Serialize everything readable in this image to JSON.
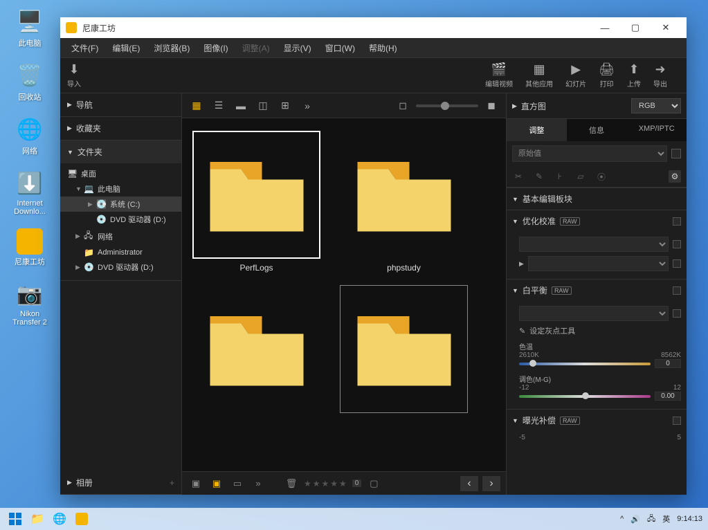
{
  "desktop": {
    "icons": [
      "此电脑",
      "回收站",
      "网络",
      "Internet Downlo...",
      "尼康工坊",
      "Nikon Transfer 2"
    ]
  },
  "window": {
    "title": "尼康工坊",
    "menu": [
      "文件(F)",
      "编辑(E)",
      "浏览器(B)",
      "图像(I)",
      "调整(A)",
      "显示(V)",
      "窗口(W)",
      "帮助(H)"
    ],
    "toolbar": {
      "import": "导入",
      "right": [
        "编辑视频",
        "其他应用",
        "幻灯片",
        "打印",
        "上传",
        "导出"
      ]
    }
  },
  "sidebar": {
    "nav": "导航",
    "fav": "收藏夹",
    "folders": "文件夹",
    "tree": {
      "desktop": "桌面",
      "thispc": "此电脑",
      "sysc": "系统 (C:)",
      "dvd": "DVD 驱动器 (D:)",
      "network": "网络",
      "admin": "Administrator",
      "dvd2": "DVD 驱动器 (D:)"
    },
    "album": "相册"
  },
  "thumbs": [
    "PerfLogs",
    "phpstudy",
    "",
    ""
  ],
  "filterbar": {
    "count": "0"
  },
  "right": {
    "histogram": "直方图",
    "rgb": "RGB",
    "tabs": [
      "调整",
      "信息",
      "XMP/IPTC"
    ],
    "original": "原始值",
    "basic": "基本编辑板块",
    "optimize": "优化校准",
    "wb": "白平衡",
    "graypoint": "设定灰点工具",
    "colortemp": "色温",
    "ct_lo": "2610K",
    "ct_hi": "8562K",
    "ct_val": "0",
    "tint": "调色(M-G)",
    "tint_lo": "-12",
    "tint_hi": "12",
    "tint_val": "0.00",
    "exposure": "曝光补偿",
    "exp_lo": "-5",
    "exp_hi": "5",
    "raw": "RAW"
  },
  "taskbar": {
    "ime": "英",
    "time": "9:14:13"
  }
}
